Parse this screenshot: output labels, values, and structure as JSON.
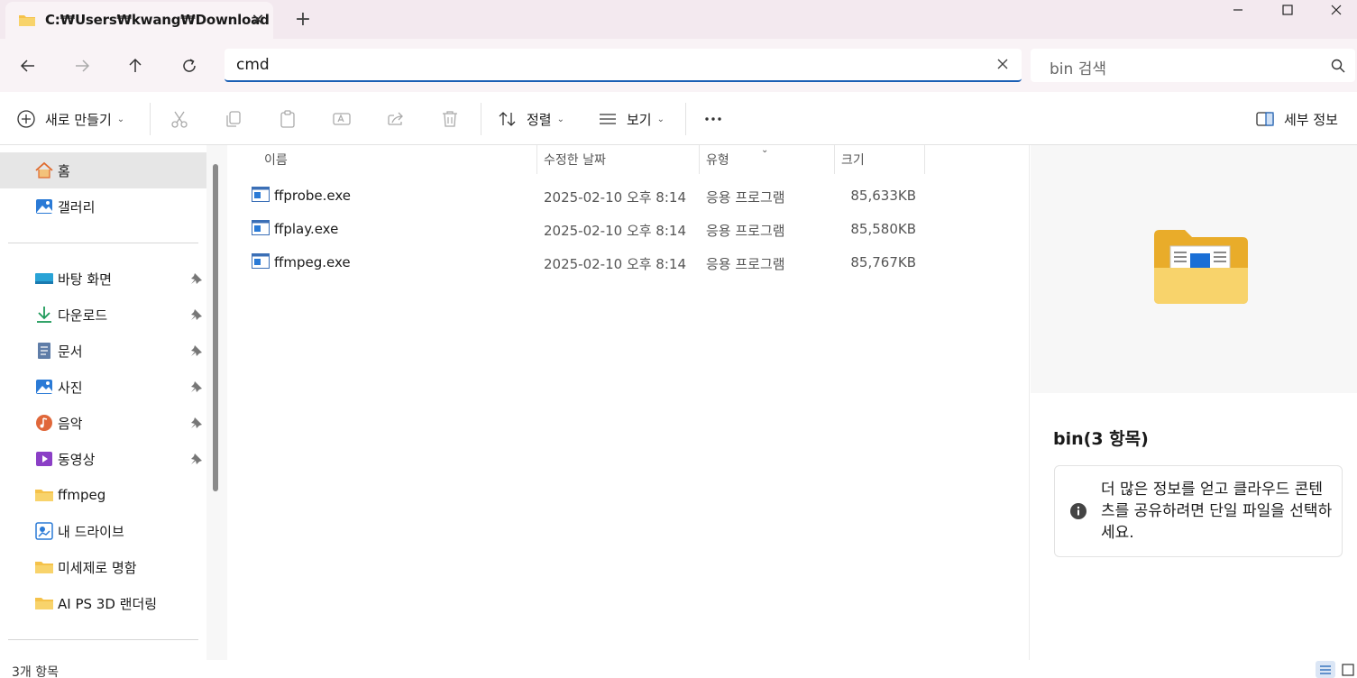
{
  "window": {
    "tab_title": "C:₩Users₩kwang₩Download",
    "tab_close_glyph": "✕",
    "new_tab_glyph": "+"
  },
  "address": {
    "value": "cmd",
    "search_placeholder": "bin 검색"
  },
  "toolbar": {
    "new_label": "새로 만들기",
    "sort_label": "정렬",
    "view_label": "보기",
    "details_label": "세부 정보"
  },
  "sidebar": {
    "items": [
      {
        "label": "홈",
        "icon": "home-icon",
        "pinned": false,
        "selected": true
      },
      {
        "label": "갤러리",
        "icon": "gallery-icon",
        "pinned": false,
        "selected": false
      },
      {
        "label": "바탕 화면",
        "icon": "desktop-icon",
        "pinned": true,
        "selected": false
      },
      {
        "label": "다운로드",
        "icon": "download-icon",
        "pinned": true,
        "selected": false
      },
      {
        "label": "문서",
        "icon": "document-icon",
        "pinned": true,
        "selected": false
      },
      {
        "label": "사진",
        "icon": "pictures-icon",
        "pinned": true,
        "selected": false
      },
      {
        "label": "음악",
        "icon": "music-icon",
        "pinned": true,
        "selected": false
      },
      {
        "label": "동영상",
        "icon": "video-icon",
        "pinned": true,
        "selected": false
      },
      {
        "label": "ffmpeg",
        "icon": "folder-icon",
        "pinned": false,
        "selected": false
      },
      {
        "label": "내 드라이브",
        "icon": "drive-icon",
        "pinned": false,
        "selected": false
      },
      {
        "label": "미세제로 명함",
        "icon": "folder-icon",
        "pinned": false,
        "selected": false
      },
      {
        "label": "AI PS 3D 랜더링",
        "icon": "folder-icon",
        "pinned": false,
        "selected": false
      }
    ]
  },
  "filelist": {
    "columns": [
      "이름",
      "수정한 날짜",
      "유형",
      "크기"
    ],
    "rows": [
      {
        "name": "ffprobe.exe",
        "date": "2025-02-10 오후 8:14",
        "type": "응용 프로그램",
        "size": "85,633KB"
      },
      {
        "name": "ffplay.exe",
        "date": "2025-02-10 오후 8:14",
        "type": "응용 프로그램",
        "size": "85,580KB"
      },
      {
        "name": "ffmpeg.exe",
        "date": "2025-02-10 오후 8:14",
        "type": "응용 프로그램",
        "size": "85,767KB"
      }
    ]
  },
  "details": {
    "title": "bin(3 항목)",
    "info": "더 많은 정보를 얻고 클라우드 콘텐츠를 공유하려면 단일 파일을 선택하세요."
  },
  "status": {
    "count": "3개 항목"
  },
  "colors": {
    "accent": "#1a5fb4",
    "titlebar_bg": "#f3e9ef",
    "nav_bg": "#f9f3f6",
    "selected_bg": "#e6e6e6",
    "folder_yellow": "#f5c24a"
  }
}
